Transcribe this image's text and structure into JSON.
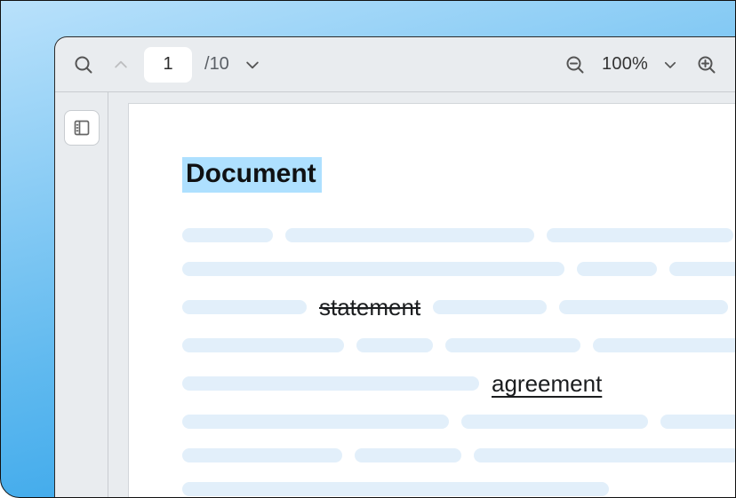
{
  "toolbar": {
    "page_current": "1",
    "page_total_prefix": "/",
    "page_total": "10",
    "zoom_label": "100%"
  },
  "document": {
    "title": "Document",
    "strike_word": "statement",
    "underline_word": "agreement"
  }
}
